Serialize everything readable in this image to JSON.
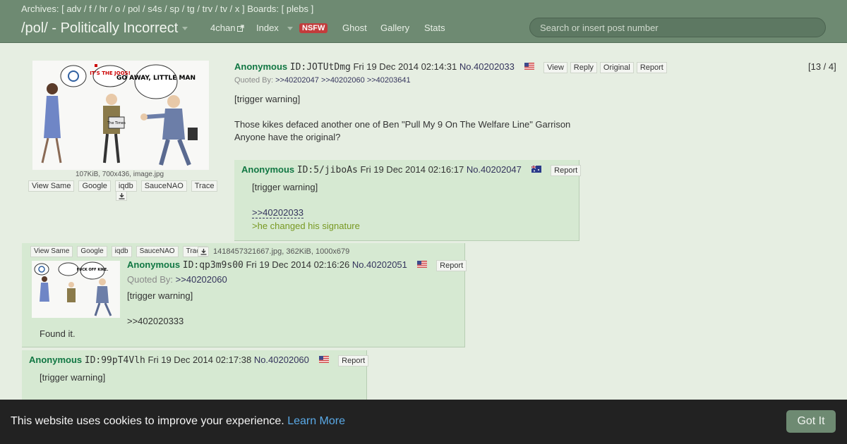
{
  "header": {
    "archives_prefix": "Archives: [",
    "archive_links": [
      "adv",
      "f",
      "hr",
      "o",
      "pol",
      "s4s",
      "sp",
      "tg",
      "trv",
      "tv",
      "x"
    ],
    "boards_text": "] Boards: [",
    "boards_link": "plebs",
    "boards_suffix": "]",
    "board_title": "/pol/ - Politically Incorrect",
    "nav": {
      "fourchan": "4chan",
      "index": "Index",
      "nsfw": "NSFW",
      "ghost": "Ghost",
      "gallery": "Gallery",
      "stats": "Stats"
    },
    "search_placeholder": "Search or insert post number"
  },
  "op": {
    "image_meta": "107KiB, 700x436, image.jpg",
    "image_buttons": [
      "View Same",
      "Google",
      "iqdb",
      "SauceNAO",
      "Trace"
    ],
    "image_text": {
      "bubble": "IT'S THE JOOS!",
      "sign": "GO AWAY, LITTLE MAN",
      "paper": "The Times"
    },
    "name": "Anonymous",
    "id": "ID:JOTUtDmg",
    "date": "Fri 19 Dec 2014 02:14:31",
    "no": "No.40202033",
    "buttons": [
      "View",
      "Reply",
      "Original",
      "Report"
    ],
    "quoted_by_label": "Quoted By:",
    "quoted_by": [
      ">>40202047",
      ">>40202060",
      ">>40203641"
    ],
    "msg_lines": [
      "[trigger warning]",
      "Those kikes defaced another one of Ben \"Pull My 9 On The Welfare Line\" Garrison",
      "Anyone have the original?"
    ],
    "counter": "[13 / 4]"
  },
  "reply1": {
    "name": "Anonymous",
    "id": "ID:5/jiboAs",
    "date": "Fri 19 Dec 2014 02:16:17",
    "no": "No.40202047",
    "report": "Report",
    "msg1": "[trigger warning]",
    "quote": ">>40202033",
    "greentext": ">he changed his signature"
  },
  "reply2": {
    "image_buttons": [
      "View Same",
      "Google",
      "iqdb",
      "SauceNAO",
      "Trace"
    ],
    "file_meta": "1418457321667.jpg, 362KiB, 1000x679",
    "image_text": {
      "bubble": "FUCK OFF KIKE."
    },
    "name": "Anonymous",
    "id": "ID:qp3m9s00",
    "date": "Fri 19 Dec 2014 02:16:26",
    "no": "No.40202051",
    "report": "Report",
    "quoted_by_label": "Quoted By:",
    "quoted_by": [
      ">>40202060"
    ],
    "msg1": "[trigger warning]",
    "msg2": ">>402020333",
    "msg3": "Found it."
  },
  "reply3": {
    "name": "Anonymous",
    "id": "ID:99pT4Vlh",
    "date": "Fri 19 Dec 2014 02:17:38",
    "no": "No.40202060",
    "report": "Report",
    "msg1": "[trigger warning]"
  },
  "cookie": {
    "text": "This website uses cookies to improve your experience.",
    "learn_more": "Learn More",
    "button": "Got It"
  }
}
